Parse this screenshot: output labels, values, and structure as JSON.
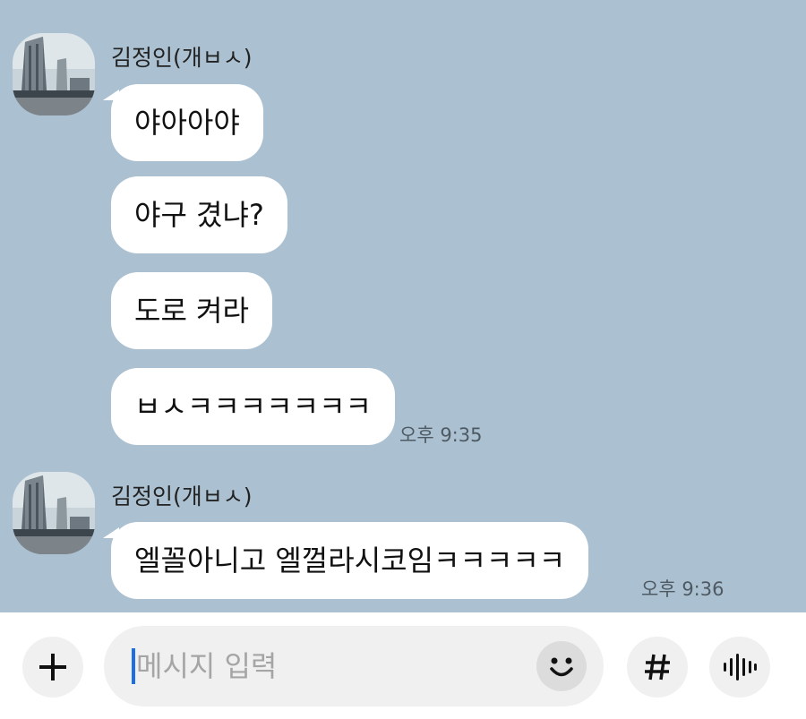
{
  "chat": {
    "groups": [
      {
        "sender": "김정인(개ㅂㅅ)",
        "messages": [
          "야아아야",
          "야구 겼냐?",
          "도로 켜라",
          "ㅂㅅㅋㅋㅋㅋㅋㅋㅋ"
        ],
        "time": "오후 9:35"
      },
      {
        "sender": "김정인(개ㅂㅅ)",
        "messages": [
          "엘꼴아니고 엘껄라시코임ㅋㅋㅋㅋㅋ"
        ],
        "time": "오후 9:36"
      }
    ]
  },
  "input_bar": {
    "placeholder": "메시지 입력",
    "icons": {
      "add": "plus-icon",
      "emoji": "emoji-icon",
      "hashtag": "hashtag-icon",
      "voice": "voice-icon"
    }
  },
  "colors": {
    "chat_background": "#abc1d1",
    "bubble": "#ffffff",
    "caret": "#1b6fe0"
  }
}
